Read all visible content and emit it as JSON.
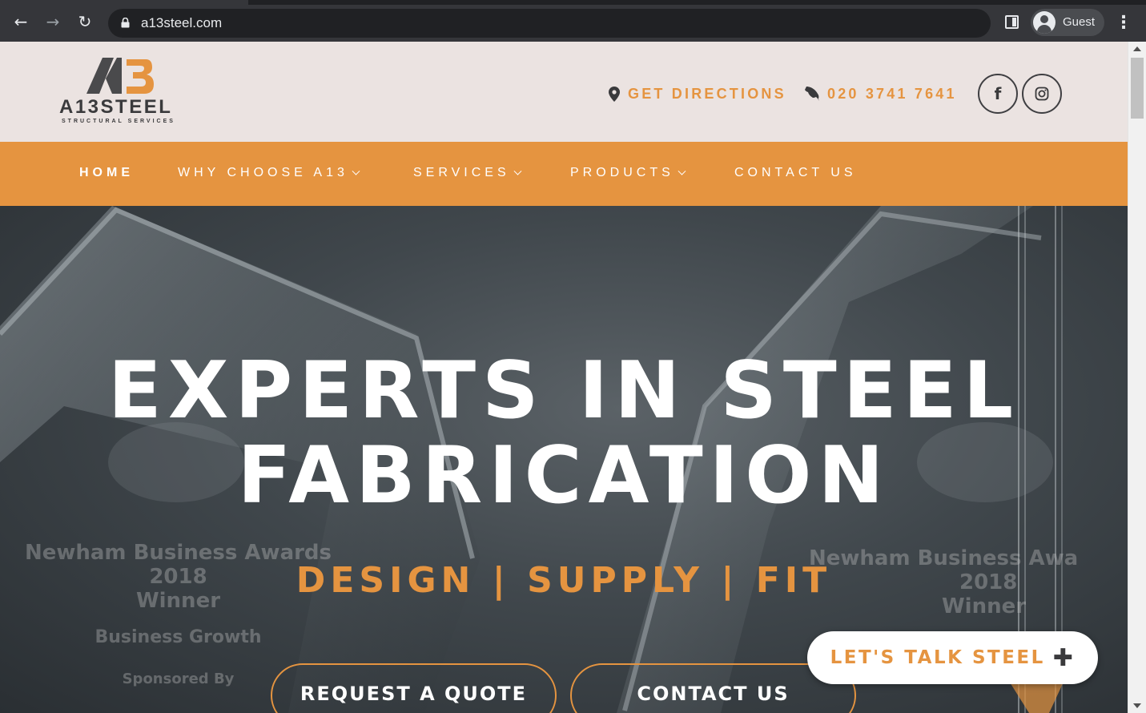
{
  "browser": {
    "url": "a13steel.com",
    "profile_name": "Guest",
    "icons": [
      "back-arrow-icon",
      "forward-arrow-icon",
      "reload-icon",
      "lock-icon",
      "side-panel-icon",
      "avatar-icon",
      "more-menu-icon"
    ]
  },
  "header": {
    "logo_text": "A13STEEL",
    "logo_subtitle": "STRUCTURAL SERVICES",
    "directions_label": "GET DIRECTIONS",
    "phone": "020 3741 7641",
    "social": [
      "facebook-icon",
      "instagram-icon"
    ]
  },
  "nav": {
    "items": [
      {
        "label": "HOME",
        "active": true,
        "dropdown": false
      },
      {
        "label": "WHY CHOOSE A13",
        "active": false,
        "dropdown": true
      },
      {
        "label": "SERVICES",
        "active": false,
        "dropdown": true
      },
      {
        "label": "PRODUCTS",
        "active": false,
        "dropdown": true
      },
      {
        "label": "CONTACT US",
        "active": false,
        "dropdown": false
      }
    ]
  },
  "hero": {
    "title_line1": "EXPERTS IN STEEL",
    "title_line2": "FABRICATION",
    "subtitle": "DESIGN | SUPPLY | FIT",
    "background_text_left": [
      "Newham Business Awards",
      "2018",
      "Winner",
      "Business Growth",
      "Sponsored By"
    ],
    "background_text_right": [
      "Newham Business Awa",
      "2018",
      "Winner"
    ],
    "buttons": {
      "quote": "REQUEST A QUOTE",
      "contact": "CONTACT US"
    }
  },
  "chat_widget": {
    "label": "LET'S TALK STEEL",
    "icon": "plus-icon"
  },
  "colors": {
    "accent": "#e59440",
    "topbar": "#ebe3e1",
    "dark": "#3a3a3c"
  }
}
